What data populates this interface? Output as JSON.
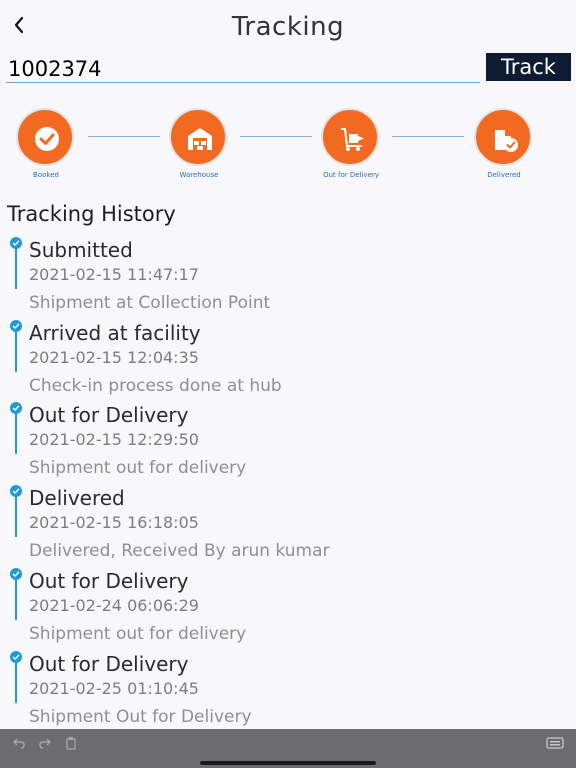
{
  "header": {
    "title": "Tracking",
    "back_icon": "chevron-left-icon"
  },
  "search": {
    "value": "1002374",
    "button_label": "Track"
  },
  "steps": [
    {
      "label": "Booked",
      "icon": "check-circle-icon"
    },
    {
      "label": "Warehouse",
      "icon": "warehouse-icon"
    },
    {
      "label": "Out for Delivery",
      "icon": "hand-truck-icon"
    },
    {
      "label": "Delivered",
      "icon": "box-check-icon"
    }
  ],
  "history": {
    "title": "Tracking History",
    "events": [
      {
        "status": "Submitted",
        "time": "2021-02-15 11:47:17",
        "desc": "Shipment at Collection Point"
      },
      {
        "status": "Arrived at facility",
        "time": "2021-02-15 12:04:35",
        "desc": "Check-in process done at hub"
      },
      {
        "status": "Out for Delivery",
        "time": "2021-02-15 12:29:50",
        "desc": "Shipment out for delivery"
      },
      {
        "status": "Delivered",
        "time": "2021-02-15 16:18:05",
        "desc": "Delivered, Received By arun kumar"
      },
      {
        "status": "Out for Delivery",
        "time": "2021-02-24 06:06:29",
        "desc": "Shipment out for delivery"
      },
      {
        "status": "Out for Delivery",
        "time": "2021-02-25 01:10:45",
        "desc": "Shipment Out for Delivery"
      }
    ]
  },
  "colors": {
    "accent": "#f26a21",
    "timeline": "#1e9bd7",
    "track_button": "#0d1b33"
  }
}
